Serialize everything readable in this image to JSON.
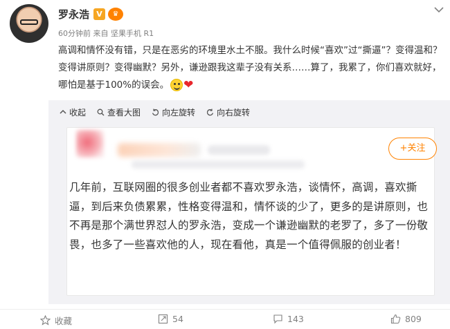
{
  "post": {
    "username": "罗永浩",
    "badges": {
      "vip": "V",
      "member": "♛"
    },
    "meta": "60分钟前 来自 坚果手机 R1",
    "text": "高调和情怀没有错，只是在恶劣的环境里水土不服。我什么时候“喜欢”过“撕逼”？变得温和？变得讲原则？变得幽默？另外，谦逊跟我这辈子没有关系……算了，我累了，你们喜欢就好，哪怕是基于100%的误会。"
  },
  "toolbar": {
    "collapse": "收起",
    "view_large": "查看大图",
    "rotate_left": "向左旋转",
    "rotate_right": "向右旋转"
  },
  "quoted_card": {
    "follow_label": "+关注",
    "text": "几年前，互联网圈的很多创业者都不喜欢罗永浩，谈情怀，高调，喜欢撕逼，到后来负债累累，性格变得温和，情怀谈的少了，更多的是讲原则，也不再是那个满世界怼人的罗永浩，变成一个谦逊幽默的老罗了，多了一份敬畏，也多了一些喜欢他的人，现在看他，真是一个值得佩服的创业者！"
  },
  "actions": {
    "favorite": "收藏",
    "repost_count": "54",
    "comment_count": "143",
    "like_count": "809"
  },
  "colors": {
    "accent": "#ff8200",
    "panel_bg": "#f2f2f5",
    "text": "#333333",
    "muted": "#808080"
  }
}
